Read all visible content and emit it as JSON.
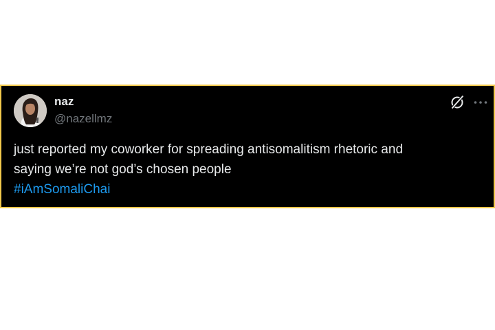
{
  "tweet": {
    "author": {
      "name": "naz",
      "handle": "@nazellmz"
    },
    "text_lines": [
      "just reported my coworker for spreading antisomalitism rhetoric and",
      "saying we’re not god’s chosen people"
    ],
    "hashtag": "#iAmSomaliChai",
    "icons": {
      "grok": "grok-icon",
      "more": "more-options-icon"
    }
  },
  "colors": {
    "card_background": "#000000",
    "card_border": "#f2c94c",
    "text_primary": "#e7e9ea",
    "text_secondary": "#71767b",
    "link": "#1d9bf0"
  }
}
